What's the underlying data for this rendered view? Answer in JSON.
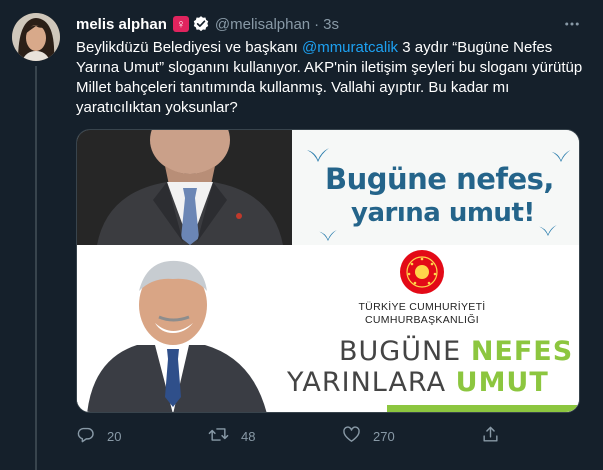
{
  "tweet": {
    "author": {
      "display_name": "melis alphan",
      "badge": "♀",
      "verified": true,
      "handle": "@melisalphan",
      "time": "3s"
    },
    "text": {
      "part1": "Beylikdüzü Belediyesi ve başkanı ",
      "mention": "@mmuratcalik",
      "part2": " 3 aydır “Bugüne Nefes Yarına Umut” sloganını kullanıyor. AKP'nin iletişim şeyleri bu sloganı yürütüp Millet bahçeleri tanıtımında kullanmış. Vallahi ayıptır. Bu kadar mı yaratıcılıktan yoksunlar?"
    },
    "media": {
      "top_right": {
        "line1": "Bugüne nefes,",
        "line2": "yarına umut!"
      },
      "bottom": {
        "institution_line1": "TÜRKİYE CUMHURİYETİ",
        "institution_line2": "CUMHURBAŞKANLIĞI",
        "slogan1_plain": "BUGÜNE ",
        "slogan1_highlight": "NEFES",
        "slogan2_plain": "YARINLARA ",
        "slogan2_highlight": "UMUT"
      }
    },
    "actions": {
      "replies": "20",
      "retweets": "48",
      "likes": "270"
    }
  },
  "colors": {
    "background": "#15202b",
    "secondary_text": "#8899a6",
    "link": "#1da1f2",
    "badge": "#e0245e",
    "slogan_green": "#8cc63f",
    "slogan_blue": "#24648a"
  },
  "icons": [
    "verified-icon",
    "more-icon",
    "reply-icon",
    "retweet-icon",
    "like-icon",
    "share-icon"
  ]
}
